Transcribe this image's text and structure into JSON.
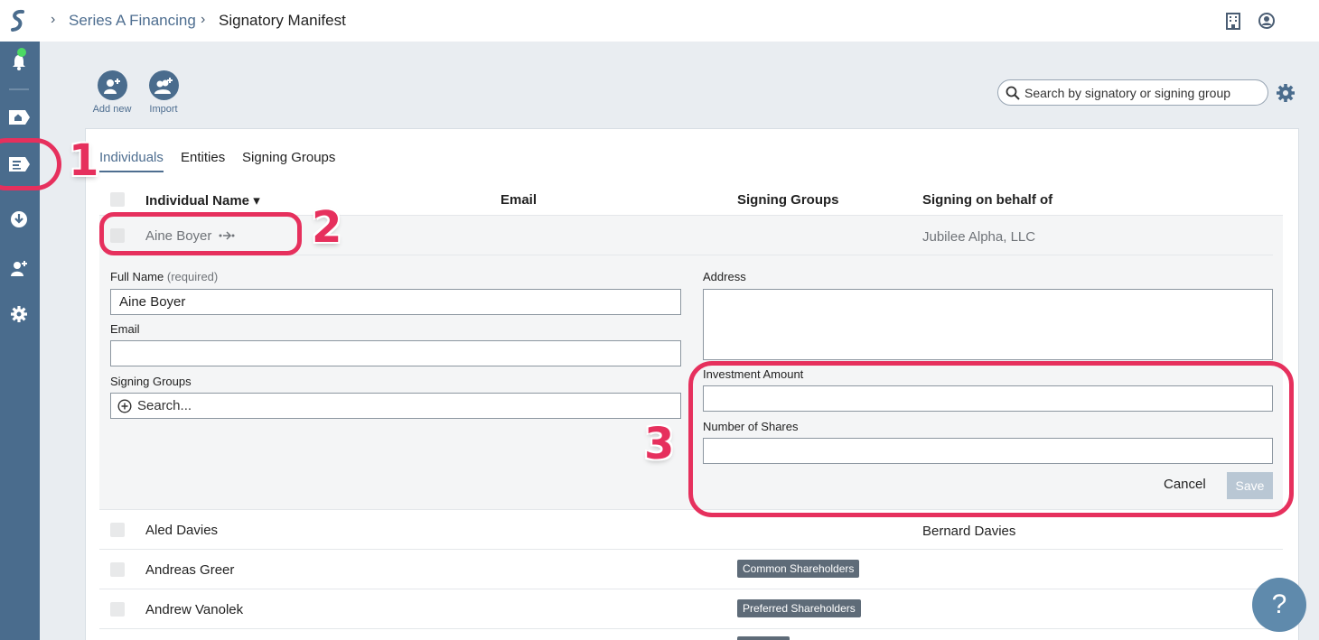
{
  "breadcrumb": {
    "parent": "Series A Financing",
    "current": "Signatory Manifest"
  },
  "toolbar": {
    "add_new_label": "Add new",
    "import_label": "Import"
  },
  "search": {
    "placeholder": "Search by signatory or signing group"
  },
  "tabs": [
    {
      "label": "Individuals",
      "active": true
    },
    {
      "label": "Entities",
      "active": false
    },
    {
      "label": "Signing Groups",
      "active": false
    }
  ],
  "table": {
    "headers": {
      "name": "Individual Name ▾",
      "email": "Email",
      "groups": "Signing Groups",
      "behalf": "Signing on behalf of"
    },
    "expanded_row": {
      "name": "Aine Boyer",
      "behalf": "Jubilee Alpha, LLC"
    },
    "rows": [
      {
        "name": "Aled Davies",
        "group": "",
        "behalf": "Bernard Davies"
      },
      {
        "name": "Andreas Greer",
        "group": "Common Shareholders",
        "behalf": ""
      },
      {
        "name": "Andrew Vanolek",
        "group": "Preferred Shareholders",
        "behalf": ""
      }
    ]
  },
  "form": {
    "full_name_label": "Full Name",
    "required_label": "(required)",
    "full_name_value": "Aine Boyer",
    "email_label": "Email",
    "email_value": "",
    "signing_groups_label": "Signing Groups",
    "signing_groups_placeholder": "Search...",
    "address_label": "Address",
    "investment_label": "Investment Amount",
    "shares_label": "Number of Shares",
    "cancel_label": "Cancel",
    "save_label": "Save"
  },
  "annotations": [
    "1",
    "2",
    "3"
  ],
  "help": {
    "label": "?"
  },
  "colors": {
    "accent": "#4e6e90",
    "sidebar": "#4a6c8d",
    "annotation": "#e6305d",
    "badge": "#5e6b78"
  }
}
